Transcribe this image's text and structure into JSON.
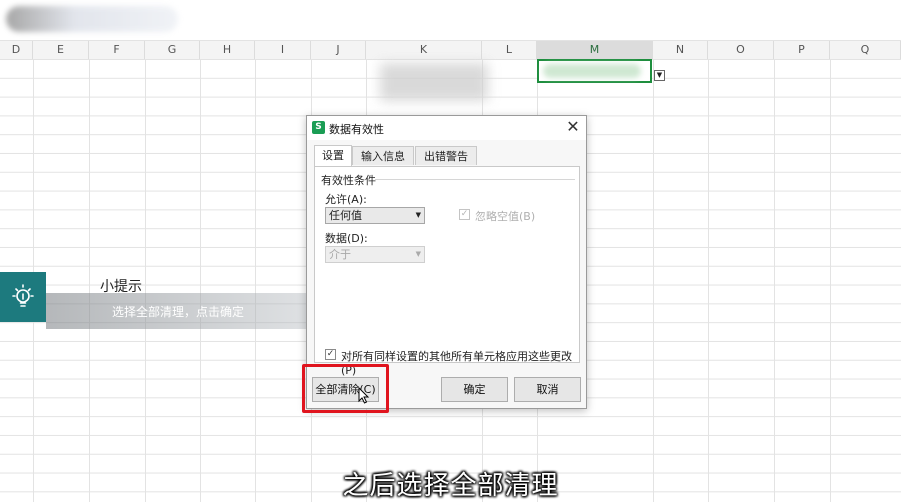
{
  "spreadsheet": {
    "columns": [
      "D",
      "E",
      "F",
      "G",
      "H",
      "I",
      "J",
      "K",
      "L",
      "M",
      "N",
      "O",
      "P",
      "Q"
    ],
    "selected_column": "M"
  },
  "tip": {
    "title": "小提示",
    "text": "选择全部清理，点击确定",
    "icon": "lightbulb-icon",
    "accent_color": "#1d7a7e"
  },
  "dialog": {
    "title": "数据有效性",
    "tabs": [
      {
        "label": "设置",
        "active": true
      },
      {
        "label": "输入信息",
        "active": false
      },
      {
        "label": "出错警告",
        "active": false
      }
    ],
    "group_title": "有效性条件",
    "allow_label": "允许(A):",
    "allow_value": "任何值",
    "ignore_blank_label": "忽略空值(B)",
    "data_label": "数据(D):",
    "data_value": "介于",
    "apply_all_label": "对所有同样设置的其他所有单元格应用这些更改(P)",
    "clear_all_button": "全部清除(C)",
    "ok_button": "确定",
    "cancel_button": "取消",
    "highlight_color": "#e0141e"
  },
  "subtitle": "之后选择全部清理"
}
